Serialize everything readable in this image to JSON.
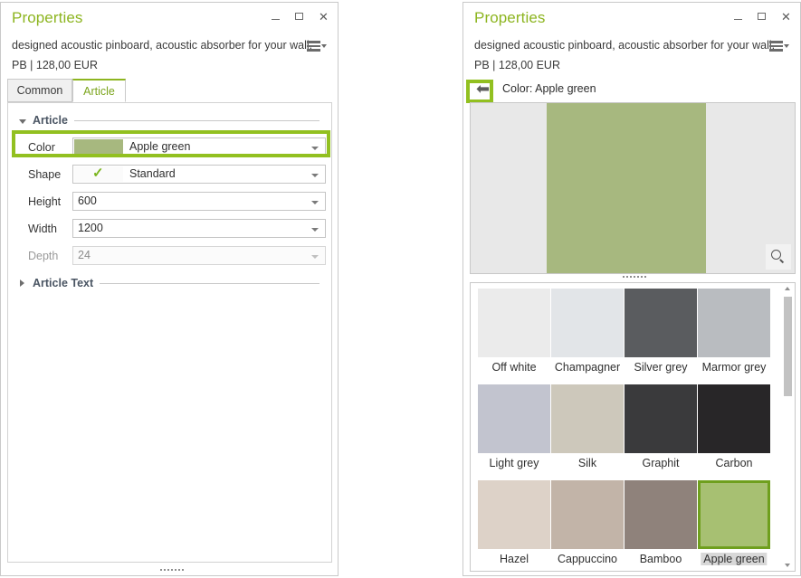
{
  "colors": {
    "accent_green": "#8db520",
    "highlight_green": "#92c020",
    "selected_border_green": "#6f9f1e",
    "apple_green_swatch": "#a7b87f",
    "panel_border": "#c9c9c9"
  },
  "left_panel": {
    "title": "Properties",
    "subtitle": "designed acoustic pinboard, acoustic absorber for your wall.",
    "price": "PB | 128,00 EUR",
    "window_buttons": [
      {
        "name": "minimize",
        "glyph": "–"
      },
      {
        "name": "maximize",
        "glyph": "□"
      },
      {
        "name": "close",
        "glyph": "✕"
      }
    ],
    "menu_icon": "hamburger-menu-icon",
    "tabs": [
      {
        "label": "Common",
        "active": false
      },
      {
        "label": "Article",
        "active": true
      }
    ],
    "group_article": {
      "label": "Article",
      "expanded": true
    },
    "group_article_text": {
      "label": "Article Text",
      "expanded": false
    },
    "fields": [
      {
        "label": "Color",
        "value": "Apple green",
        "kind": "color",
        "enabled": true,
        "highlighted": true
      },
      {
        "label": "Shape",
        "value": "Standard",
        "kind": "check",
        "enabled": true,
        "highlighted": false
      },
      {
        "label": "Height",
        "value": "600",
        "kind": "text",
        "enabled": true,
        "highlighted": false
      },
      {
        "label": "Width",
        "value": "1200",
        "kind": "text",
        "enabled": true,
        "highlighted": false
      },
      {
        "label": "Depth",
        "value": "24",
        "kind": "text",
        "enabled": false,
        "highlighted": false
      }
    ]
  },
  "right_panel": {
    "title": "Properties",
    "subtitle": "designed acoustic pinboard, acoustic absorber for your wall.",
    "price": "PB | 128,00 EUR",
    "window_buttons": [
      {
        "name": "minimize",
        "glyph": "–"
      },
      {
        "name": "maximize",
        "glyph": "□"
      },
      {
        "name": "close",
        "glyph": "✕"
      }
    ],
    "menu_icon": "hamburger-menu-icon",
    "back_button_icon": "arrow-left-icon",
    "back_label": "Color: Apple green",
    "preview": {
      "swatch_color": "#a7b87f",
      "zoom_icon": "magnifier-icon"
    },
    "swatches": [
      {
        "label": "Off white",
        "color": "#ebebeb",
        "selected": false
      },
      {
        "label": "Champagner",
        "color": "#e2e5e8",
        "selected": false
      },
      {
        "label": "Silver grey",
        "color": "#5a5c5f",
        "selected": false
      },
      {
        "label": "Marmor grey",
        "color": "#b9bcc0",
        "selected": false
      },
      {
        "label": "Light grey",
        "color": "#c2c4cf",
        "selected": false
      },
      {
        "label": "Silk",
        "color": "#cdc8bb",
        "selected": false
      },
      {
        "label": "Graphit",
        "color": "#3a3a3c",
        "selected": false
      },
      {
        "label": "Carbon",
        "color": "#282628",
        "selected": false
      },
      {
        "label": "Hazel",
        "color": "#ddd2c8",
        "selected": false
      },
      {
        "label": "Cappuccino",
        "color": "#c2b4a8",
        "selected": false
      },
      {
        "label": "Bamboo",
        "color": "#8f827b",
        "selected": false
      },
      {
        "label": "Apple green",
        "color": "#a7c072",
        "selected": true
      }
    ],
    "scrollbar": {
      "up_arrow_icon": "caret-up-icon",
      "down_arrow_icon": "caret-down-icon"
    }
  }
}
